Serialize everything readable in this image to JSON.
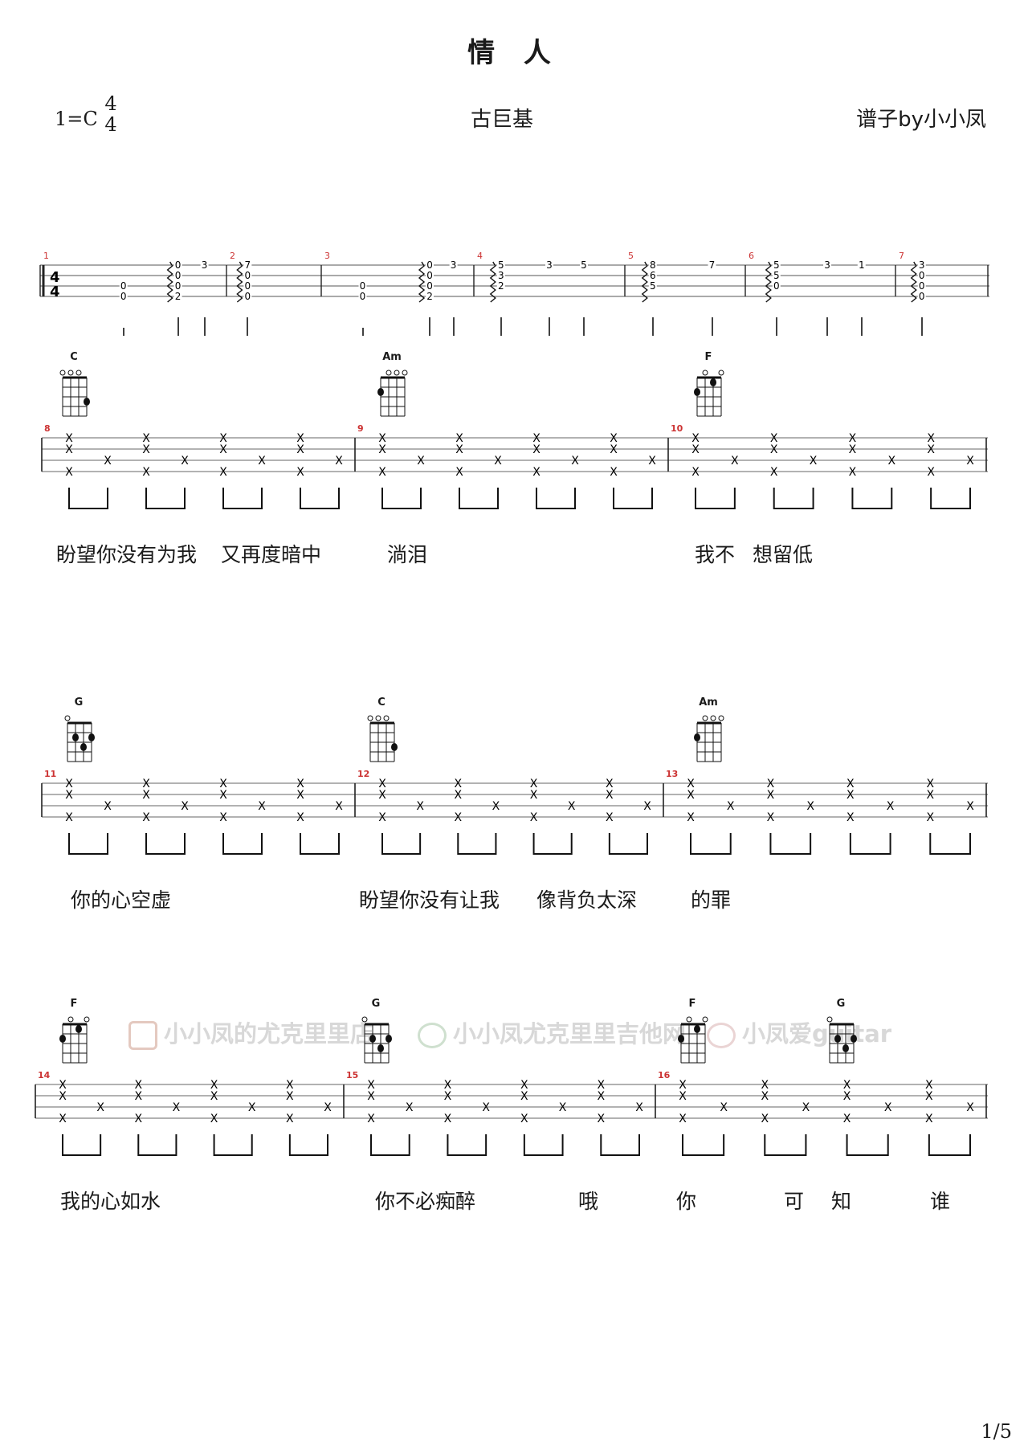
{
  "title": "情 人",
  "key_signature": "1=C",
  "time_signature": {
    "top": "4",
    "bottom": "4"
  },
  "singer": "古巨基",
  "credit": "谱子by小小凤",
  "page": "1/5",
  "watermark": {
    "taobao": "小小凤的尤克里里店",
    "wechat": "小小凤尤克里里吉他网",
    "weibo": "小凤爱guitar"
  },
  "intro": [
    {
      "n": "1",
      "notes": [
        {
          "x": 0.38,
          "s": 3,
          "f": "0"
        },
        {
          "x": 0.38,
          "s": 4,
          "f": "0"
        },
        {
          "x": 0.73,
          "s": 1,
          "f": "0",
          "arp": true
        },
        {
          "x": 0.73,
          "s": 2,
          "f": "0"
        },
        {
          "x": 0.73,
          "s": 3,
          "f": "0"
        },
        {
          "x": 0.73,
          "s": 4,
          "f": "2"
        },
        {
          "x": 0.9,
          "s": 1,
          "f": "3"
        }
      ]
    },
    {
      "n": "2",
      "notes": [
        {
          "x": 0.18,
          "s": 1,
          "f": "7",
          "arp": true
        },
        {
          "x": 0.18,
          "s": 2,
          "f": "0"
        },
        {
          "x": 0.18,
          "s": 3,
          "f": "0"
        },
        {
          "x": 0.18,
          "s": 4,
          "f": "0"
        }
      ]
    },
    {
      "n": "3",
      "notes": [
        {
          "x": 0.25,
          "s": 3,
          "f": "0"
        },
        {
          "x": 0.25,
          "s": 4,
          "f": "0"
        },
        {
          "x": 0.73,
          "s": 1,
          "f": "0",
          "arp": true
        },
        {
          "x": 0.73,
          "s": 2,
          "f": "0"
        },
        {
          "x": 0.73,
          "s": 3,
          "f": "0"
        },
        {
          "x": 0.73,
          "s": 4,
          "f": "2"
        },
        {
          "x": 0.9,
          "s": 1,
          "f": "3"
        }
      ]
    },
    {
      "n": "4",
      "notes": [
        {
          "x": 0.15,
          "s": 1,
          "f": "5",
          "arp": true
        },
        {
          "x": 0.15,
          "s": 2,
          "f": "3"
        },
        {
          "x": 0.15,
          "s": 3,
          "f": "2"
        },
        {
          "x": 0.5,
          "s": 1,
          "f": "3"
        },
        {
          "x": 0.75,
          "s": 1,
          "f": "5"
        }
      ]
    },
    {
      "n": "5",
      "notes": [
        {
          "x": 0.2,
          "s": 1,
          "f": "8",
          "arp": true
        },
        {
          "x": 0.2,
          "s": 2,
          "f": "6"
        },
        {
          "x": 0.2,
          "s": 3,
          "f": "5"
        },
        {
          "x": 0.75,
          "s": 1,
          "f": "7"
        }
      ]
    },
    {
      "n": "6",
      "notes": [
        {
          "x": 0.18,
          "s": 1,
          "f": "5",
          "arp": true
        },
        {
          "x": 0.18,
          "s": 2,
          "f": "5"
        },
        {
          "x": 0.18,
          "s": 3,
          "f": "0"
        },
        {
          "x": 0.55,
          "s": 1,
          "f": "3"
        },
        {
          "x": 0.8,
          "s": 1,
          "f": "1"
        }
      ]
    },
    {
      "n": "7",
      "notes": [
        {
          "x": 0.25,
          "s": 1,
          "f": "3",
          "arp": true
        },
        {
          "x": 0.25,
          "s": 2,
          "f": "0"
        },
        {
          "x": 0.25,
          "s": 3,
          "f": "0"
        },
        {
          "x": 0.25,
          "s": 4,
          "f": "0"
        }
      ]
    }
  ],
  "systems": [
    {
      "measures": [
        "8",
        "9",
        "10"
      ],
      "chords": [
        {
          "name": "C",
          "dots": [
            [
              4,
              3
            ]
          ]
        },
        {
          "name": "Am",
          "dots": [
            [
              1,
              2
            ]
          ]
        },
        {
          "name": "F",
          "dots": [
            [
              1,
              2
            ],
            [
              3,
              1
            ]
          ]
        }
      ],
      "lyrics": [
        "盼望你没有为我",
        "又再度暗中",
        "淌泪",
        "我不",
        "想留低"
      ]
    },
    {
      "measures": [
        "11",
        "12",
        "13"
      ],
      "chords": [
        {
          "name": "G",
          "dots": [
            [
              2,
              2
            ],
            [
              3,
              3
            ],
            [
              4,
              2
            ]
          ]
        },
        {
          "name": "C",
          "dots": [
            [
              4,
              3
            ]
          ]
        },
        {
          "name": "Am",
          "dots": [
            [
              1,
              2
            ]
          ]
        }
      ],
      "lyrics": [
        "你的心空虚",
        "盼望你没有让我",
        "像背负太深",
        "的罪"
      ]
    },
    {
      "measures": [
        "14",
        "15",
        "16"
      ],
      "chords": [
        {
          "name": "F",
          "dots": [
            [
              1,
              2
            ],
            [
              3,
              1
            ]
          ]
        },
        {
          "name": "G",
          "dots": [
            [
              2,
              2
            ],
            [
              3,
              3
            ],
            [
              4,
              2
            ]
          ]
        },
        {
          "name": "F",
          "dots": [
            [
              1,
              2
            ],
            [
              3,
              1
            ]
          ]
        },
        {
          "name": "G",
          "dots": [
            [
              2,
              2
            ],
            [
              3,
              3
            ],
            [
              4,
              2
            ]
          ]
        }
      ],
      "lyrics": [
        "我的心如水",
        "你不必痴醉",
        "哦",
        "你",
        "可",
        "知",
        "谁"
      ]
    }
  ]
}
